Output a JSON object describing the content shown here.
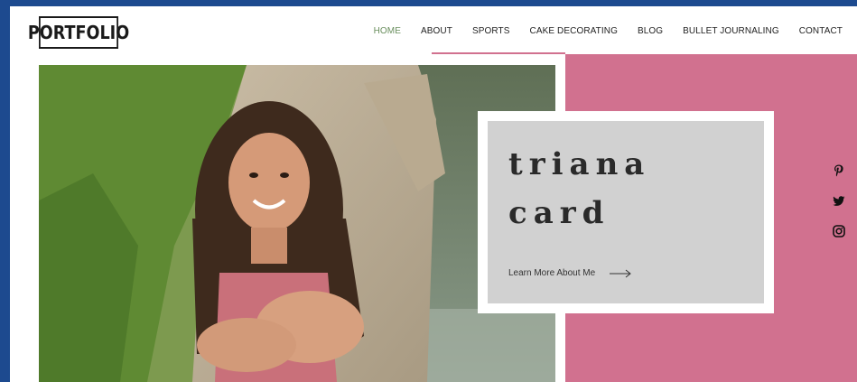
{
  "logo": {
    "text": "PORTFOLIO"
  },
  "nav": {
    "items": [
      {
        "label": "HOME"
      },
      {
        "label": "ABOUT"
      },
      {
        "label": "SPORTS"
      },
      {
        "label": "CAKE DECORATING"
      },
      {
        "label": "BLOG"
      },
      {
        "label": "BULLET JOURNALING"
      },
      {
        "label": "CONTACT"
      }
    ]
  },
  "hero": {
    "title_line1": "triana",
    "title_line2": "card",
    "cta_label": "Learn More About Me"
  },
  "social": {
    "icons": [
      "pinterest-icon",
      "twitter-icon",
      "instagram-icon"
    ]
  },
  "colors": {
    "accent_pink": "#d1718f",
    "nav_active": "#6a8f5e",
    "frame_blue": "#1d4a8f",
    "card_gray": "#d1d1d1"
  }
}
